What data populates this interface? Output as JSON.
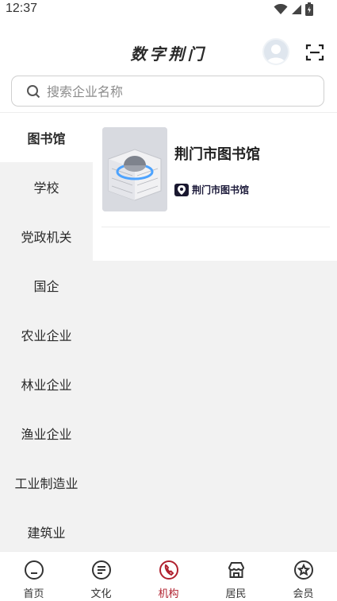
{
  "status_bar": {
    "time": "12:37"
  },
  "header": {
    "title": "数字荆门"
  },
  "search": {
    "placeholder": "搜索企业名称"
  },
  "sidebar": {
    "items": [
      {
        "label": "图书馆",
        "active": true
      },
      {
        "label": "学校"
      },
      {
        "label": "党政机关"
      },
      {
        "label": "国企"
      },
      {
        "label": "农业企业"
      },
      {
        "label": "林业企业"
      },
      {
        "label": "渔业企业"
      },
      {
        "label": "工业制造业"
      },
      {
        "label": "建筑业"
      }
    ]
  },
  "content": {
    "cards": [
      {
        "title": "荆门市图书馆",
        "tag": "荆门市图书馆"
      }
    ]
  },
  "bottom_nav": {
    "items": [
      {
        "label": "首页",
        "icon": "home-icon"
      },
      {
        "label": "文化",
        "icon": "document-icon"
      },
      {
        "label": "机构",
        "icon": "phone-icon",
        "active": true
      },
      {
        "label": "居民",
        "icon": "store-icon"
      },
      {
        "label": "会员",
        "icon": "star-badge-icon"
      }
    ]
  },
  "colors": {
    "accent": "#b0202e",
    "sidebar_bg": "#f2f2f2",
    "tag_bg": "#1a1830"
  }
}
